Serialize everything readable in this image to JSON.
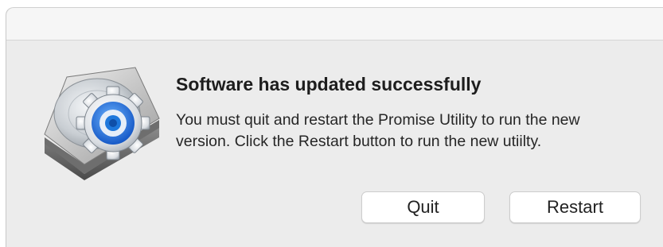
{
  "dialog": {
    "icon": "promise-utility-disk-gear-icon",
    "heading": "Software has updated successfully",
    "message": "You must quit and restart the Promise Utility to run the new version. Click the Restart button to run the new utiilty.",
    "buttons": {
      "quit_label": "Quit",
      "restart_label": "Restart"
    }
  },
  "colors": {
    "dialog_background": "#ececec",
    "button_background": "#ffffff",
    "icon_accent": "#1e78dc"
  }
}
